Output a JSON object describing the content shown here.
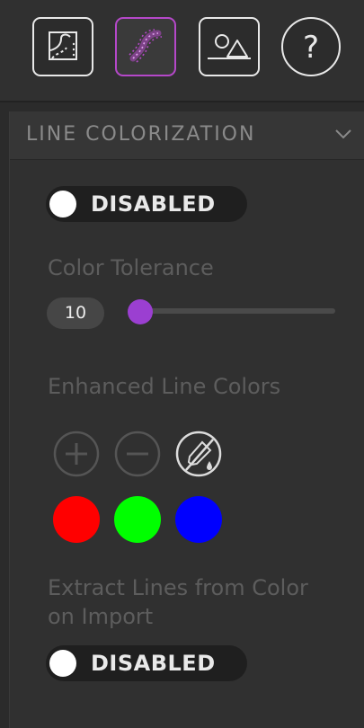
{
  "toolbar": {
    "tools": [
      {
        "name": "vectorize-tool",
        "active": false
      },
      {
        "name": "line-tool",
        "active": true
      },
      {
        "name": "image-tool",
        "active": false
      },
      {
        "name": "help",
        "active": false,
        "glyph": "?"
      }
    ],
    "colors": {
      "active_border": "#b548c9",
      "border": "#e8e8e8"
    }
  },
  "panel": {
    "title": "LINE COLORIZATION",
    "colorization_toggle": {
      "label": "DISABLED",
      "enabled": false
    },
    "color_tolerance": {
      "label": "Color Tolerance",
      "value": "10"
    },
    "enhanced_line_colors": {
      "label": "Enhanced Line Colors",
      "actions": [
        "add-icon",
        "remove-icon",
        "eyedropper-off-icon"
      ],
      "swatches": [
        "#ff0000",
        "#00ff00",
        "#0000ff"
      ]
    },
    "extract_lines": {
      "label_line1": "Extract Lines from Color",
      "label_line2": "on Import",
      "toggle": {
        "label": "DISABLED",
        "enabled": false
      }
    }
  },
  "colors": {
    "slider_thumb": "#9b3fd1",
    "background": "#2b2b2b"
  }
}
